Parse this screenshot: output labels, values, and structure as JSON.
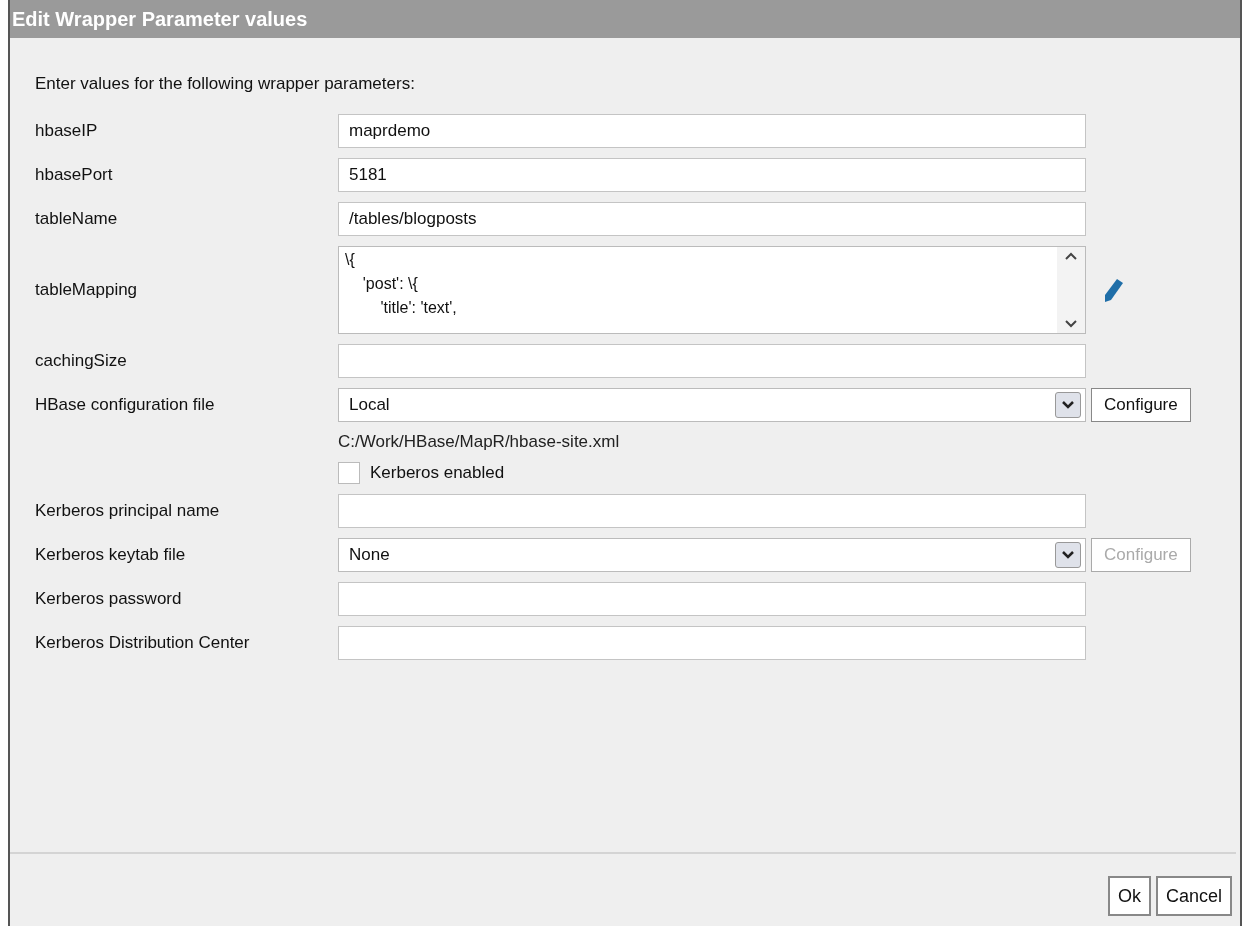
{
  "dialog": {
    "title": "Edit Wrapper Parameter values",
    "intro": "Enter values for the following wrapper parameters:",
    "fields": [
      {
        "kind": "text",
        "label": "hbaseIP",
        "value": "maprdemo"
      },
      {
        "kind": "text",
        "label": "hbasePort",
        "value": "5181"
      },
      {
        "kind": "text",
        "label": "tableName",
        "value": "/tables/blogposts"
      },
      {
        "kind": "textarea",
        "label": "tableMapping",
        "value": "\\{\n    'post': \\{\n        'title': 'text',"
      },
      {
        "kind": "text",
        "label": "cachingSize"
      },
      {
        "kind": "select",
        "label": "HBase configuration file",
        "value": "Local",
        "button": {
          "label": "Configure",
          "disabled": false
        }
      },
      {
        "kind": "note",
        "value": "C:/Work/HBase/MapR/hbase-site.xml"
      },
      {
        "kind": "checkbox",
        "value": "Kerberos enabled",
        "checked": false
      },
      {
        "kind": "text",
        "label": "Kerberos principal name"
      },
      {
        "kind": "select",
        "label": "Kerberos keytab file",
        "value": "None",
        "button": {
          "label": "Configure",
          "disabled": true
        }
      },
      {
        "kind": "text",
        "label": "Kerberos password"
      },
      {
        "kind": "text",
        "label": "Kerberos Distribution Center"
      }
    ],
    "buttons": [
      "Ok",
      "Cancel"
    ]
  }
}
